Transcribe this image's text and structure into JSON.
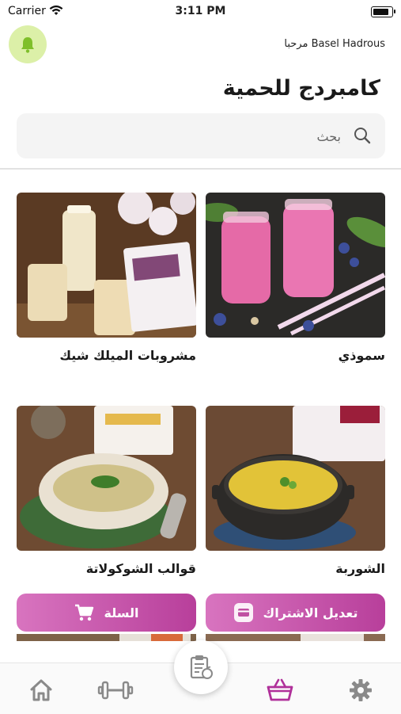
{
  "status_bar": {
    "carrier": "Carrier",
    "time": "3:11 PM"
  },
  "header": {
    "greeting": "مرحبا Basel Hadrous",
    "title": "كامبردج للحمية"
  },
  "search": {
    "placeholder": "بحث"
  },
  "categories": [
    {
      "label": "سموذي"
    },
    {
      "label": "مشروبات الميلك شيك"
    },
    {
      "label": "الشوربة"
    },
    {
      "label": "قوالب الشوكولاتة"
    }
  ],
  "actions": {
    "edit_subscription_label": "تعديل الاشتراك",
    "cart_label": "السلة"
  },
  "colors": {
    "accent": "#c04fa2",
    "bell_bg": "#dcf0a8",
    "nav_active": "#b0309a"
  }
}
